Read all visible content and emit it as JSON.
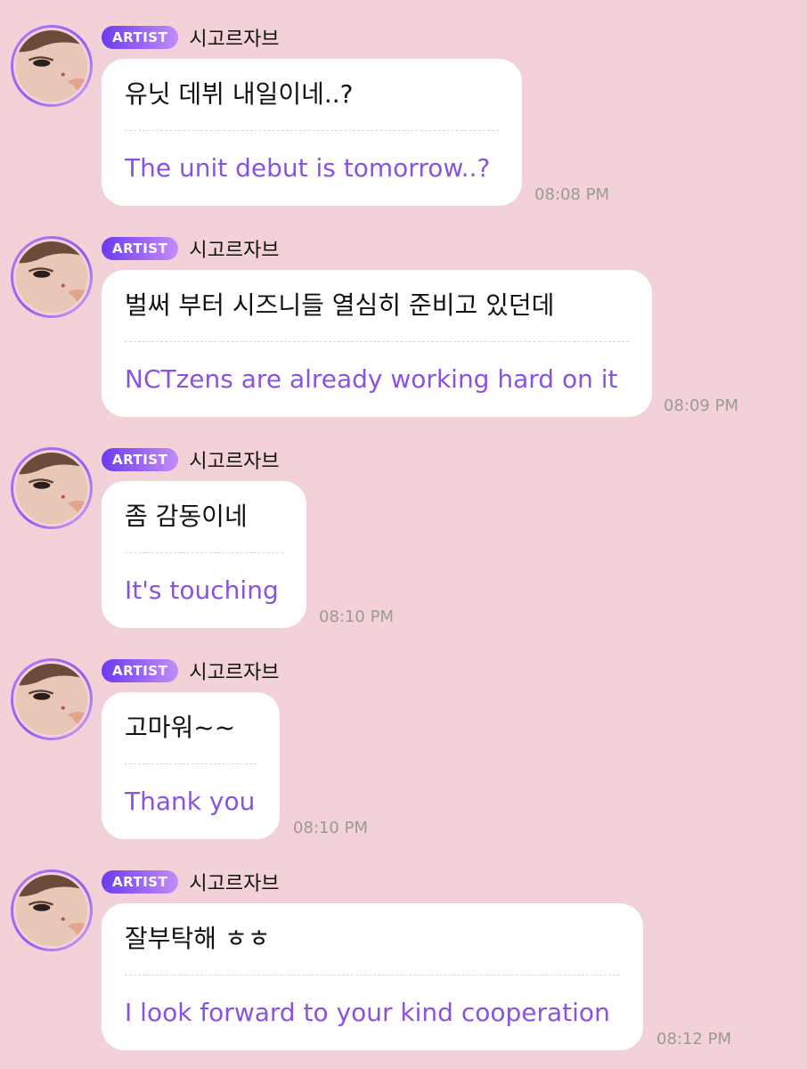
{
  "chat": {
    "badge_label": "ARTIST",
    "sender_name": "시고르자브",
    "accent_color": "#8a52e2",
    "background_color": "#f2d1d8",
    "messages": [
      {
        "original": "유닛 데뷔 내일이네..?",
        "translation": "The unit debut is tomorrow..?",
        "time": "08:08 PM"
      },
      {
        "original": "벌써 부터 시즈니들 열심히 준비고 있던데",
        "translation": "NCTzens are already working hard on it",
        "time": "08:09 PM"
      },
      {
        "original": "좀 감동이네",
        "translation": "It's touching",
        "time": "08:10 PM"
      },
      {
        "original": "고마워~~",
        "translation": "Thank you",
        "time": "08:10 PM"
      },
      {
        "original": "잘부탁해 ㅎㅎ",
        "translation": "I look forward to your kind cooperation",
        "time": "08:12 PM"
      }
    ]
  }
}
